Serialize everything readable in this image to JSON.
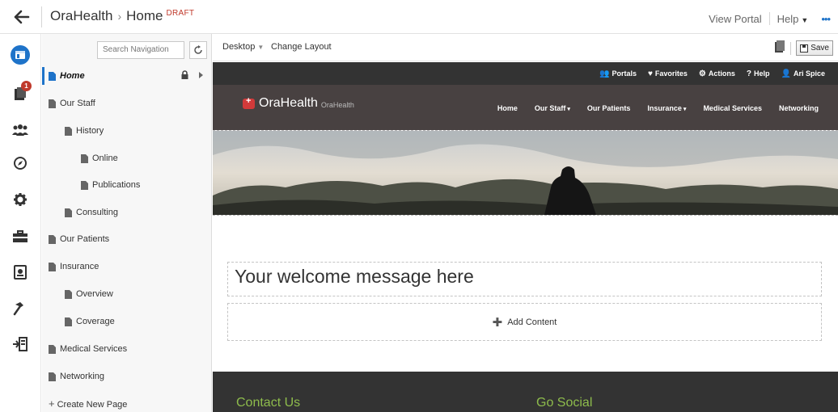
{
  "topbar": {
    "site": "OraHealth",
    "separator": "›",
    "page": "Home",
    "status": "DRAFT",
    "view_portal": "View Portal",
    "help": "Help",
    "more": "•••"
  },
  "rail": {
    "icons": [
      "pages-icon",
      "messages-icon",
      "people-icon",
      "compass-icon",
      "settings-icon",
      "toolbox-icon",
      "assets-icon",
      "build-icon",
      "export-icon"
    ],
    "messages_badge": "1"
  },
  "nav": {
    "search_placeholder": "Search Navigation",
    "items": [
      {
        "label": "Home"
      },
      {
        "label": "Our Staff"
      },
      {
        "label": "History"
      },
      {
        "label": "Online"
      },
      {
        "label": "Publications"
      },
      {
        "label": "Consulting"
      },
      {
        "label": "Our Patients"
      },
      {
        "label": "Insurance"
      },
      {
        "label": "Overview"
      },
      {
        "label": "Coverage"
      },
      {
        "label": "Medical Services"
      },
      {
        "label": "Networking"
      }
    ],
    "create": "Create New Page"
  },
  "editor": {
    "device": "Desktop",
    "change_layout": "Change Layout",
    "save": "Save"
  },
  "site": {
    "util": {
      "portals": "Portals",
      "favorites": "Favorites",
      "actions": "Actions",
      "help": "Help",
      "user": "Ari Spice"
    },
    "brand": "OraHealth",
    "brand_sub": "OraHealth",
    "nav": {
      "home": "Home",
      "staff": "Our Staff",
      "patients": "Our Patients",
      "insurance": "Insurance",
      "medical": "Medical Services",
      "networking": "Networking"
    },
    "welcome": "Your welcome message here",
    "add_content": "Add Content",
    "footer": {
      "contact": "Contact Us",
      "social": "Go Social"
    }
  },
  "colors": {
    "accent": "#1e73c9",
    "draft": "#c0392b",
    "header": "#484141",
    "topnav": "#333333",
    "footer_heading": "#8ebc4c"
  }
}
